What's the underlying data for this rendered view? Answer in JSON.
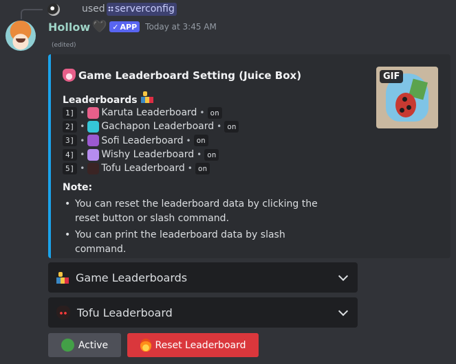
{
  "reply": {
    "used_text": "used",
    "command": "serverconfig"
  },
  "message": {
    "username": "Hollow",
    "username_color": "#9ed3c6",
    "heart": "🖤",
    "app_badge": "APP",
    "timestamp": "Today at 3:45 AM",
    "edited": "(edited)"
  },
  "embed": {
    "accent_color": "#1ba3ea",
    "title": "Game Leaderboard Setting (Juice Box)",
    "title_icon": "fox-icon",
    "thumbnail_badge": "GIF",
    "section_title": "Leaderboards",
    "section_icon": "trophy-icon",
    "leaderboards": [
      {
        "index": "1]",
        "name": "Karuta Leaderboard",
        "status": "on",
        "icon": "karuta-icon",
        "icon_color": "#e75f8a"
      },
      {
        "index": "2]",
        "name": "Gachapon Leaderboard",
        "status": "on",
        "icon": "gachapon-icon",
        "icon_color": "#35c6d8"
      },
      {
        "index": "3]",
        "name": "Sofi Leaderboard",
        "status": "on",
        "icon": "sofi-icon",
        "icon_color": "#9b59d0"
      },
      {
        "index": "4]",
        "name": "Wishy Leaderboard",
        "status": "on",
        "icon": "wishy-icon",
        "icon_color": "#b68cf0"
      },
      {
        "index": "5]",
        "name": "Tofu Leaderboard",
        "status": "on",
        "icon": "tofu-icon",
        "icon_color": "#3a2424"
      }
    ],
    "separator": "•",
    "note_title": "Note:",
    "notes": [
      "You can reset the leaderboard data by clicking the reset button or slash command.",
      "You can print the leaderboard data by slash command."
    ]
  },
  "components": {
    "select_1": {
      "label": "Game Leaderboards",
      "icon": "trophy-icon"
    },
    "select_2": {
      "label": "Tofu Leaderboard",
      "icon": "tofu-icon"
    },
    "active_button": {
      "label": "Active",
      "icon": "green-circle-icon"
    },
    "reset_button": {
      "label": "Reset Leaderboard",
      "icon": "fire-icon",
      "color": "#da373c"
    }
  }
}
